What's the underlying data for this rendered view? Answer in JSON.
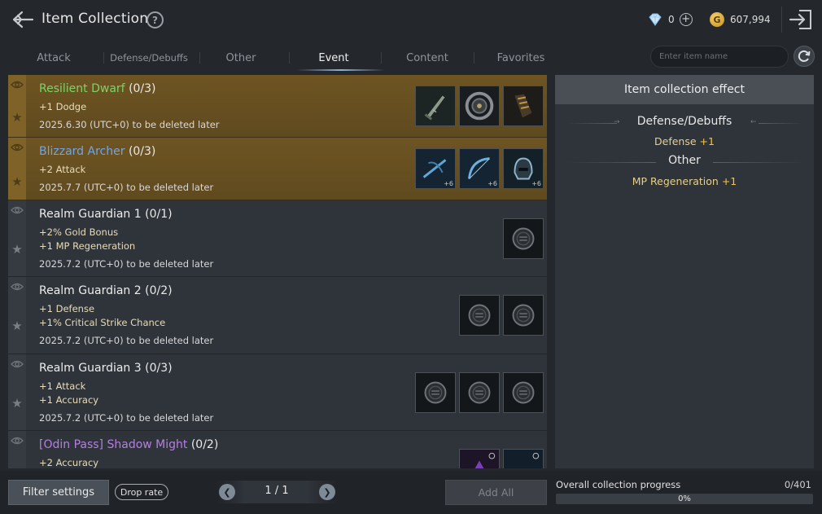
{
  "header": {
    "title": "Item Collection",
    "help_icon": "help-icon",
    "diamonds": "0",
    "gold_symbol": "G",
    "gold": "607,994"
  },
  "tabs": [
    {
      "label": "Attack",
      "active": false
    },
    {
      "label": "Defense/Debuffs",
      "active": false
    },
    {
      "label": "Other",
      "active": false
    },
    {
      "label": "Event",
      "active": true
    },
    {
      "label": "Content",
      "active": false
    },
    {
      "label": "Favorites",
      "active": false
    }
  ],
  "search": {
    "placeholder": "Enter item name",
    "value": ""
  },
  "collections": [
    {
      "name": "Resilient Dwarf",
      "count": "(0/3)",
      "stats": [
        "+1 Dodge"
      ],
      "deadline": "2025.6.30 (UTC+0) to be deleted later",
      "style": "gold",
      "name_color": "green",
      "items": [
        "dagger-icon",
        "shield-ring-icon",
        "gauntlet-icon"
      ],
      "enhance": [
        "",
        "",
        ""
      ]
    },
    {
      "name": "Blizzard Archer",
      "count": "(0/3)",
      "stats": [
        "+2 Attack"
      ],
      "deadline": "2025.7.7 (UTC+0) to be deleted later",
      "style": "gold",
      "name_color": "blue",
      "items": [
        "crossbow-icon",
        "bow-icon",
        "helmet-icon"
      ],
      "enhance": [
        "+6",
        "+6",
        "+6"
      ]
    },
    {
      "name": "Realm Guardian 1",
      "count": "(0/1)",
      "stats": [
        "+2% Gold Bonus",
        "+1 MP Regeneration"
      ],
      "deadline": "2025.7.2 (UTC+0) to be deleted later",
      "style": "gray",
      "name_color": "white",
      "items": [
        "coin-icon"
      ],
      "enhance": [
        ""
      ]
    },
    {
      "name": "Realm Guardian 2",
      "count": "(0/2)",
      "stats": [
        "+1 Defense",
        "+1% Critical Strike Chance"
      ],
      "deadline": "2025.7.2 (UTC+0) to be deleted later",
      "style": "gray",
      "name_color": "white",
      "items": [
        "coin-icon",
        "coin-icon"
      ],
      "enhance": [
        "",
        ""
      ]
    },
    {
      "name": "Realm Guardian 3",
      "count": "(0/3)",
      "stats": [
        "+1 Attack",
        "+1 Accuracy"
      ],
      "deadline": "2025.7.2 (UTC+0) to be deleted later",
      "style": "gray",
      "name_color": "white",
      "items": [
        "coin-icon",
        "coin-icon",
        "coin-icon"
      ],
      "enhance": [
        "",
        "",
        ""
      ]
    },
    {
      "name": "[Odin Pass] Shadow Might",
      "count": "(0/2)",
      "stats": [
        "+2 Accuracy"
      ],
      "deadline": "",
      "style": "gray",
      "name_color": "purple",
      "items": [
        "purple-gem-icon",
        "blue-gem-icon"
      ],
      "enhance": [
        "",
        ""
      ]
    }
  ],
  "effects": {
    "title": "Item collection effect",
    "groups": [
      {
        "category": "Defense/Debuffs",
        "stat": "Defense",
        "value": "+1"
      },
      {
        "category": "Other",
        "stat": "MP Regeneration",
        "value": "+1"
      }
    ]
  },
  "footer": {
    "filter_label": "Filter settings",
    "drop_rate_label": "Drop rate",
    "page": "1 / 1",
    "add_all_label": "Add All",
    "progress_label": "Overall collection progress",
    "progress_count": "0/401",
    "progress_percent": "0%",
    "progress_fraction": 0
  },
  "colors": {
    "event_row": "#6e5422",
    "normal_row": "#2f343a",
    "accent_gold": "#f5c542",
    "name_green": "#7fd16a",
    "name_blue": "#6fa6e8",
    "name_purple": "#b67ee3"
  }
}
